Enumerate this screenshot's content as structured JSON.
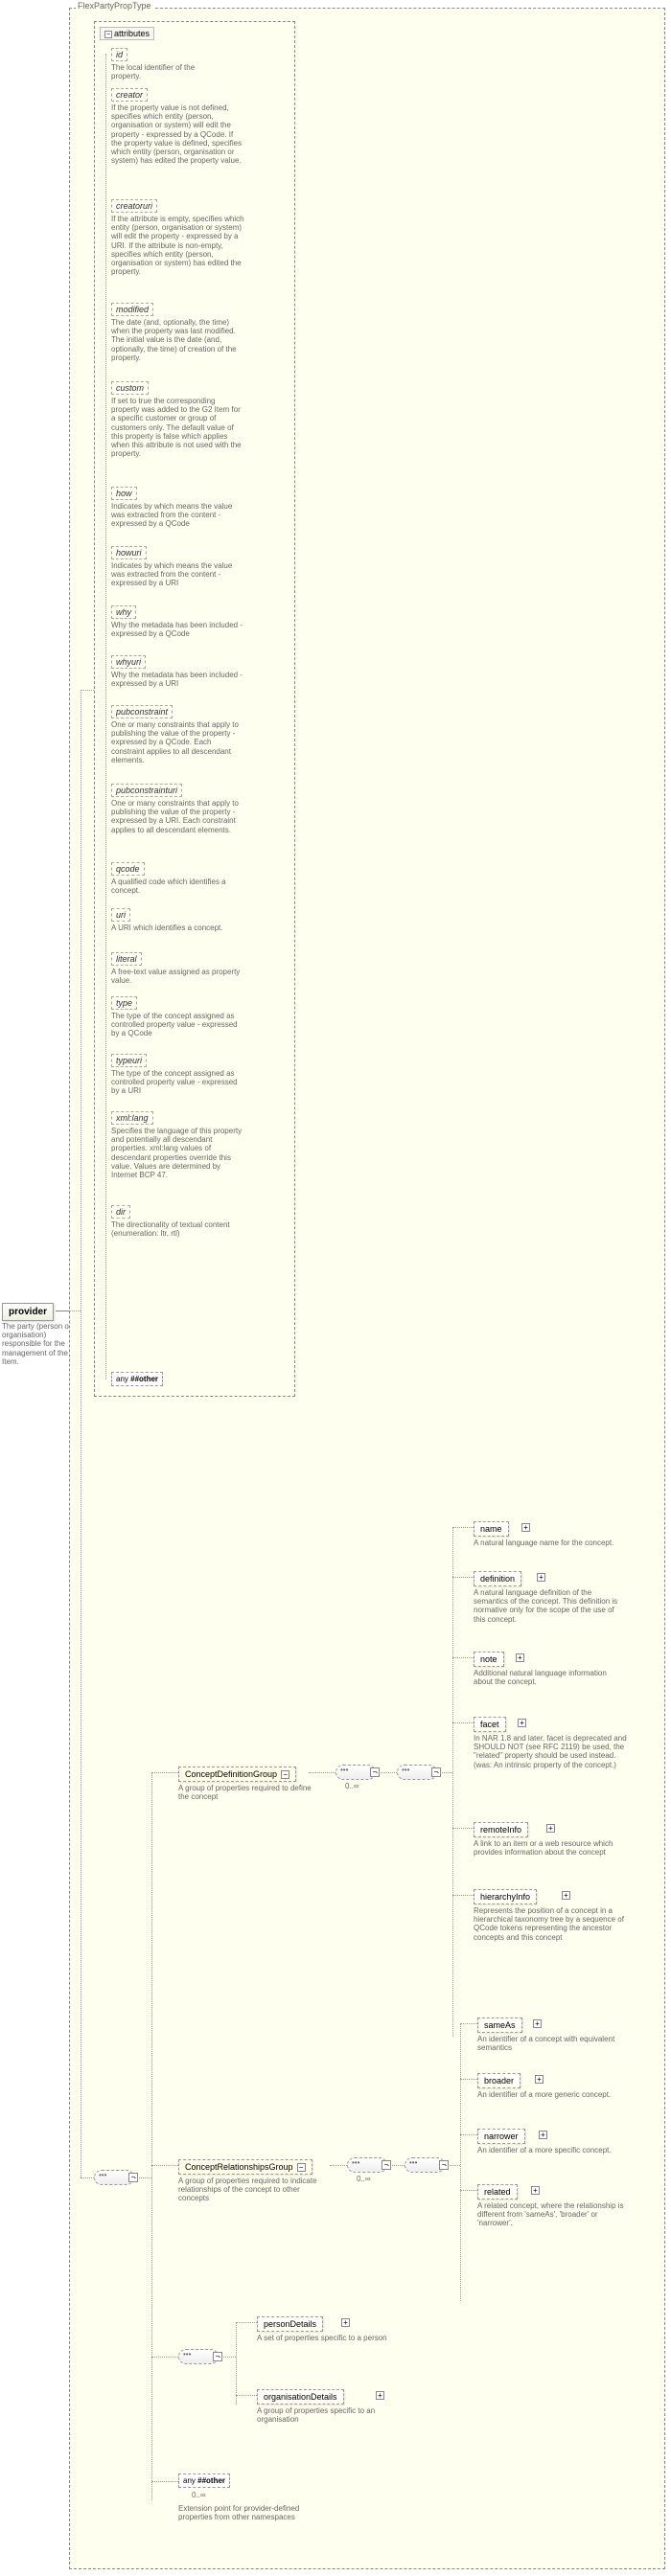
{
  "root_type": "FlexPartyPropType",
  "provider": {
    "label": "provider",
    "desc": "The party (person or organisation) responsible for the management of the Item."
  },
  "attributes_label": "attributes",
  "attrs": [
    {
      "name": "id",
      "desc": "The local identifier of the property."
    },
    {
      "name": "creator",
      "desc": "If the property value is not defined, specifies which entity (person, organisation or system) will edit the property - expressed by a QCode. If the property value is defined, specifies which entity (person, organisation or system) has edited the property value."
    },
    {
      "name": "creatoruri",
      "desc": "If the attribute is empty, specifies which entity (person, organisation or system) will edit the property - expressed by a URI. If the attribute is non-empty, specifies which entity (person, organisation or system) has edited the property."
    },
    {
      "name": "modified",
      "desc": "The date (and, optionally, the time) when the property was last modified. The initial value is the date (and, optionally, the time) of creation of the property."
    },
    {
      "name": "custom",
      "desc": "If set to true the corresponding property was added to the G2 Item for a specific customer or group of customers only. The default value of this property is false which applies when this attribute is not used with the property."
    },
    {
      "name": "how",
      "desc": "Indicates by which means the value was extracted from the content - expressed by a QCode"
    },
    {
      "name": "howuri",
      "desc": "Indicates by which means the value was extracted from the content - expressed by a URI"
    },
    {
      "name": "why",
      "desc": "Why the metadata has been included - expressed by a QCode"
    },
    {
      "name": "whyuri",
      "desc": "Why the metadata has been included - expressed by a URI"
    },
    {
      "name": "pubconstraint",
      "desc": "One or many constraints that apply to publishing the value of the property - expressed by a QCode. Each constraint applies to all descendant elements."
    },
    {
      "name": "pubconstrainturi",
      "desc": "One or many constraints that apply to publishing the value of the property - expressed by a URI. Each constraint applies to all descendant elements."
    },
    {
      "name": "qcode",
      "desc": "A qualified code which identifies a concept."
    },
    {
      "name": "uri",
      "desc": "A URI which identifies a concept."
    },
    {
      "name": "literal",
      "desc": "A free-text value assigned as property value."
    },
    {
      "name": "type",
      "desc": "The type of the concept assigned as controlled property value - expressed by a QCode"
    },
    {
      "name": "typeuri",
      "desc": "The type of the concept assigned as controlled property value - expressed by a URI"
    },
    {
      "name": "xml:lang",
      "desc": "Specifies the language of this property and potentially all descendant properties. xml:lang values of descendant properties override this value. Values are determined by Internet BCP 47."
    },
    {
      "name": "dir",
      "desc": "The directionality of textual content (enumeration: ltr, rtl)"
    }
  ],
  "any_other": "##other",
  "any_label": "any",
  "groups": {
    "def": {
      "name": "ConceptDefinitionGroup",
      "desc": "A group of properties required to define the concept"
    },
    "rel": {
      "name": "ConceptRelationshipsGroup",
      "desc": "A group of properties required to indicate relationships of the concept to other concepts"
    }
  },
  "def_children": [
    {
      "name": "name",
      "desc": "A natural language name for the concept."
    },
    {
      "name": "definition",
      "desc": "A natural language definition of the semantics of the concept. This definition is normative only for the scope of the use of this concept."
    },
    {
      "name": "note",
      "desc": "Additional natural language information about the concept."
    },
    {
      "name": "facet",
      "desc": "In NAR 1.8 and later, facet is deprecated and SHOULD NOT (see RFC 2119) be used, the \"related\" property should be used instead. (was: An intrinsic property of the concept.)"
    },
    {
      "name": "remoteInfo",
      "desc": "A link to an item or a web resource which provides information about the concept"
    },
    {
      "name": "hierarchyInfo",
      "desc": "Represents the position of a concept in a hierarchical taxonomy tree by a sequence of QCode tokens representing the ancestor concepts and this concept"
    }
  ],
  "rel_children": [
    {
      "name": "sameAs",
      "desc": "An identifier of a concept with equivalent semantics"
    },
    {
      "name": "broader",
      "desc": "An identifier of a more generic concept."
    },
    {
      "name": "narrower",
      "desc": "An identifier of a more specific concept."
    },
    {
      "name": "related",
      "desc": "A related concept, where the relationship is different from 'sameAs', 'broader' or 'narrower'."
    }
  ],
  "person": {
    "name": "personDetails",
    "desc": "A set of properties specific to a person"
  },
  "org": {
    "name": "organisationDetails",
    "desc": "A group of properties specific to an organisation"
  },
  "ext": {
    "label": "##other",
    "desc": "Extension point for provider-defined properties from other namespaces"
  },
  "occ": "0..∞"
}
